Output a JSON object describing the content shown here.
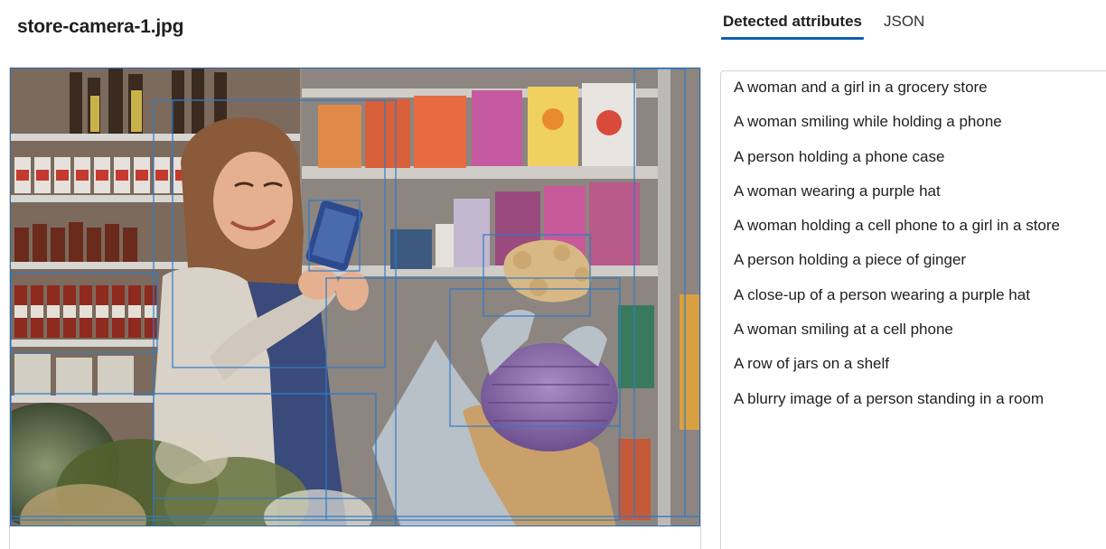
{
  "file": {
    "name": "store-camera-1.jpg"
  },
  "tabs": [
    {
      "label": "Detected attributes",
      "active": true
    },
    {
      "label": "JSON",
      "active": false
    }
  ],
  "attributes": [
    "A woman and a girl in a grocery store",
    "A woman smiling while holding a phone",
    "A person holding a phone case",
    "A woman wearing a purple hat",
    "A woman holding a cell phone to a girl in a store",
    "A person holding a piece of ginger",
    "A close-up of a person wearing a purple hat",
    "A woman smiling at a cell phone",
    "A row of jars on a shelf",
    "A blurry image of a person standing in a room"
  ],
  "colors": {
    "accent": "#0f5fb5",
    "bbox": "#2f7bc8",
    "border": "#d4d4d4"
  }
}
